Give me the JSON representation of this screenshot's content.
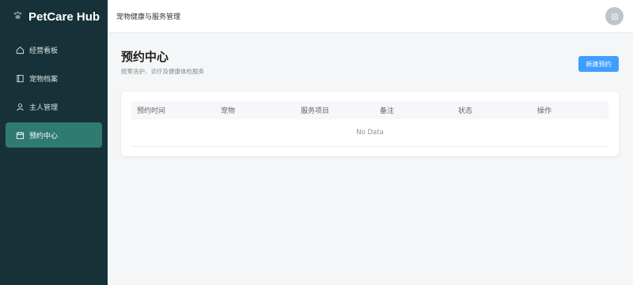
{
  "brand": {
    "name": "PetCare Hub",
    "logo_icon": "paw-icon"
  },
  "sidebar": {
    "items": [
      {
        "label": "经营看板",
        "icon": "home-icon",
        "active": false
      },
      {
        "label": "宠物档案",
        "icon": "book-icon",
        "active": false
      },
      {
        "label": "主人管理",
        "icon": "user-icon",
        "active": false
      },
      {
        "label": "预约中心",
        "icon": "calendar-icon",
        "active": true
      }
    ]
  },
  "topbar": {
    "title": "宠物健康与服务管理",
    "avatar_icon": "user-avatar-icon"
  },
  "main": {
    "title": "预约中心",
    "subtitle": "统筹洗护、诊疗及健康体检服务",
    "new_button": "新建预约",
    "table": {
      "columns": [
        "预约时间",
        "宠物",
        "服务项目",
        "备注",
        "状态",
        "操作"
      ],
      "rows": [],
      "empty_text": "No Data"
    }
  },
  "colors": {
    "sidebar": "#163238",
    "active": "#2f7a71",
    "primary": "#409eff"
  }
}
